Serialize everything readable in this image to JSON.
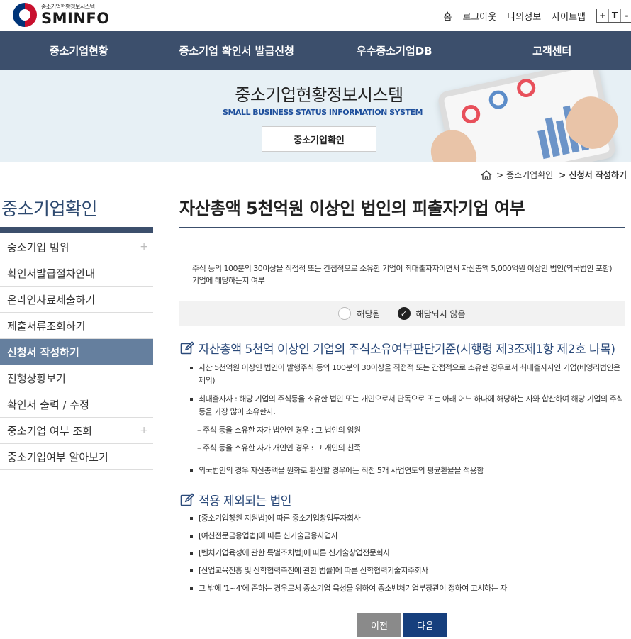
{
  "header": {
    "logo_sub": "중소기업현황정보시스템",
    "logo_main": "SMINFO",
    "util_links": [
      "홈",
      "로그아웃",
      "나의정보",
      "사이트맵"
    ],
    "font_controls": [
      "+",
      "T",
      "-"
    ]
  },
  "gnb": {
    "items": [
      "중소기업현황",
      "중소기업 확인서 발급신청",
      "우수중소기업DB",
      "고객센터"
    ]
  },
  "banner": {
    "title": "중소기업현황정보시스템",
    "subtitle": "SMALL BUSINESS STATUS INFORMATION SYSTEM",
    "button": "중소기업확인"
  },
  "breadcrumb": {
    "items": [
      "중소기업확인",
      "신청서 작성하기"
    ]
  },
  "sidebar": {
    "title": "중소기업확인",
    "items": [
      {
        "label": "중소기업 범위",
        "has_plus": true
      },
      {
        "label": "확인서발급절차안내"
      },
      {
        "label": "온라인자료제출하기"
      },
      {
        "label": "제출서류조회하기"
      },
      {
        "label": "신청서 작성하기",
        "active": true
      },
      {
        "label": "진행상황보기"
      },
      {
        "label": "확인서 출력 / 수정"
      },
      {
        "label": "중소기업 여부 조회",
        "has_plus": true
      },
      {
        "label": "중소기업여부 알아보기"
      }
    ]
  },
  "main": {
    "title": "자산총액 5천억원 이상인 법인의 피출자기업 여부",
    "question": "주식 등의 100분의 30이상을 직접적 또는 간접적으로 소유한 기업이 최대출자자이면서 자산총액 5,000억원 이상인 법인(외국법인 포함)기업에 해당하는지 여부",
    "options": {
      "yes": "해당됨",
      "no": "해당되지 않음",
      "selected": "no"
    },
    "section1": {
      "heading": "자산총액 5천억 이상인 기업의 주식소유여부판단기준(시행령 제3조제1항 제2호 나목)",
      "bullets": [
        "자산 5천억원 이상인 법인이 발행주식 등의 100분의 30이상을 직접적 또는 간접적으로 소유한 경우로서 최대출자자인 기업(비영리법인은 제외)",
        "최대출자자 : 해당 기업의 주식등을 소유한 법인 또는 개인으로서 단독으로 또는 아래 어느 하나에 해당하는 자와 합산하여 해당 기업의 주식등을 가장 많이 소유한자."
      ],
      "dashes": [
        "– 주식 등을 소유한 자가 법인인 경우 : 그 법인의 임원",
        "– 주식 등을 소유한 자가 개인인 경우 : 그 개인의 친족"
      ],
      "bullet_last": "외국법인의 경우 자산총액을 원화로 환산할 경우에는 직전 5개 사업연도의 평균환율을 적용함"
    },
    "section2": {
      "heading": "적용 제외되는 법인",
      "bullets": [
        "[중소기업창원 지원법]에 따른 중소기업창업투자회사",
        "[여신전문금융업법]에 따른 신기술금융사업자",
        "[벤처기업육성에 관한 특별조치법]에 따른 신기술창업전문회사",
        "[산업교육진흥 및 산학협력촉진에 관한 법률]에 따른 산학협력기술지주회사",
        "그 밖에 '1~4'에 준하는 경우로서 중소기업 육성을 위하여 중소벤처기업부장관이 정하여 고시하는 자"
      ]
    },
    "buttons": {
      "prev": "이전",
      "next": "다음"
    }
  }
}
